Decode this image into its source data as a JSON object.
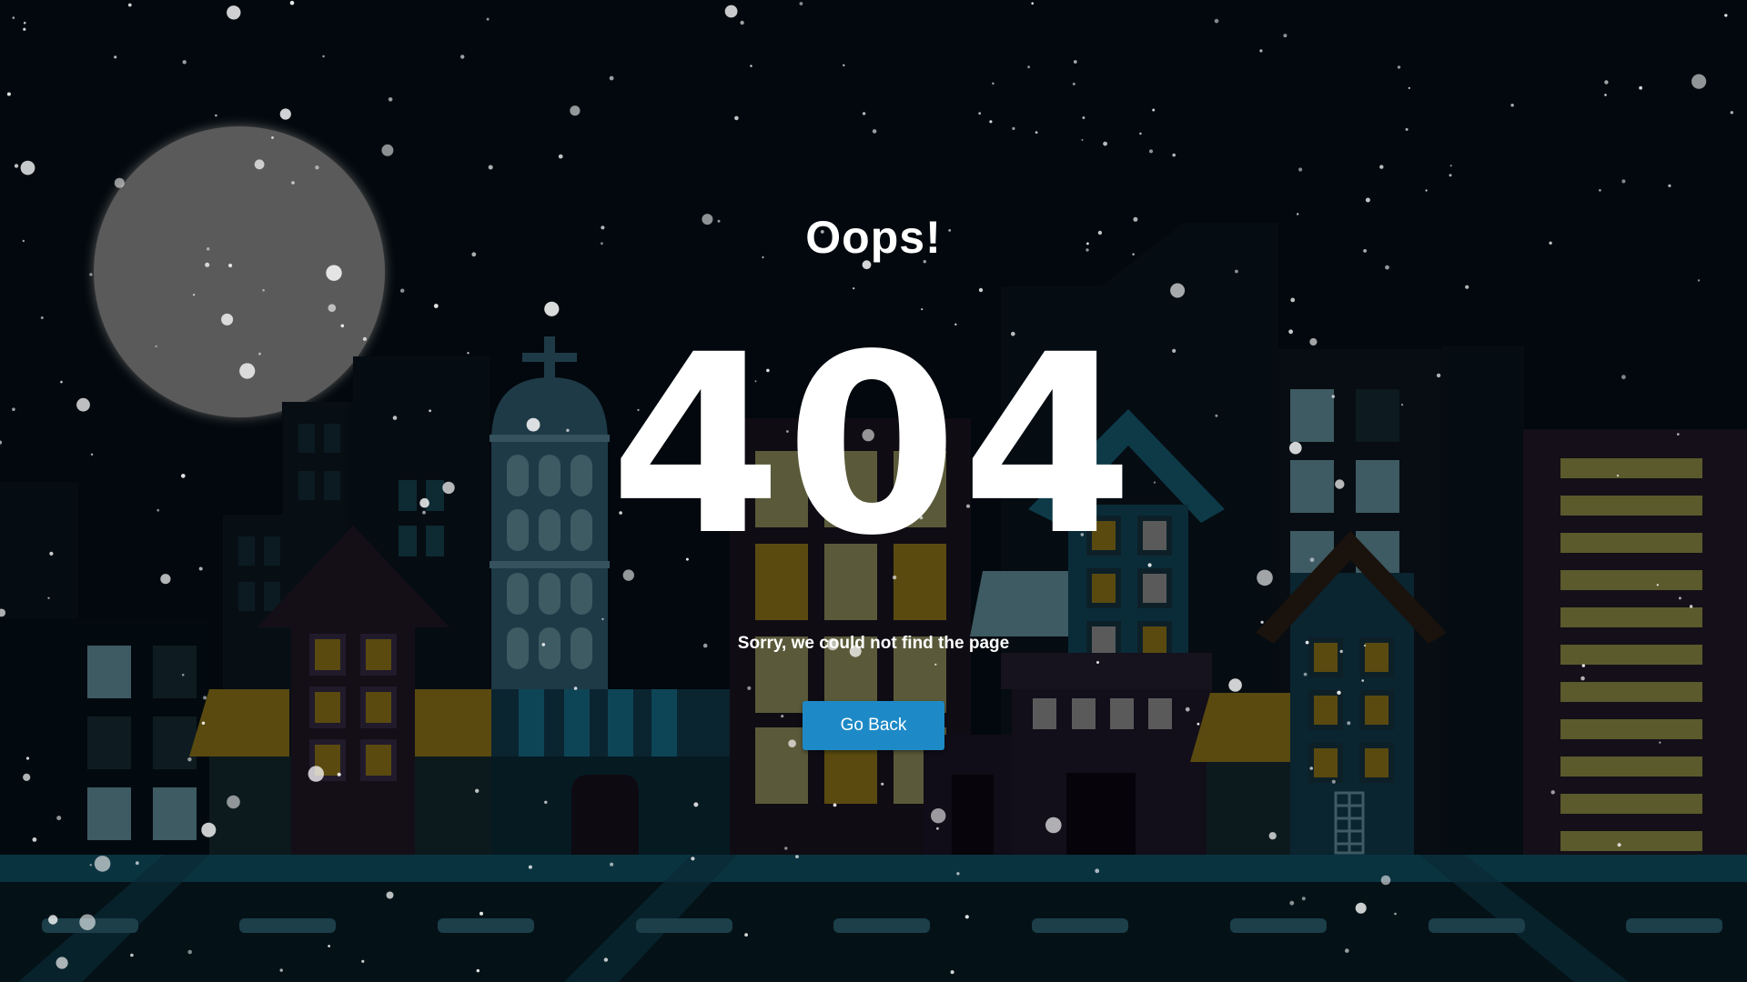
{
  "heading": "Oops!",
  "error_code": "404",
  "message": "Sorry, we could not find the page",
  "button": {
    "label": "Go Back"
  },
  "colors": {
    "background": "#02080d",
    "moon": "#5a5a5a",
    "window_yellow": "#5a4a10",
    "accent_blue": "#1d8ac7",
    "road": "#0a3340"
  },
  "icons": [
    "moon-icon",
    "cross-icon",
    "ladder-icon"
  ]
}
